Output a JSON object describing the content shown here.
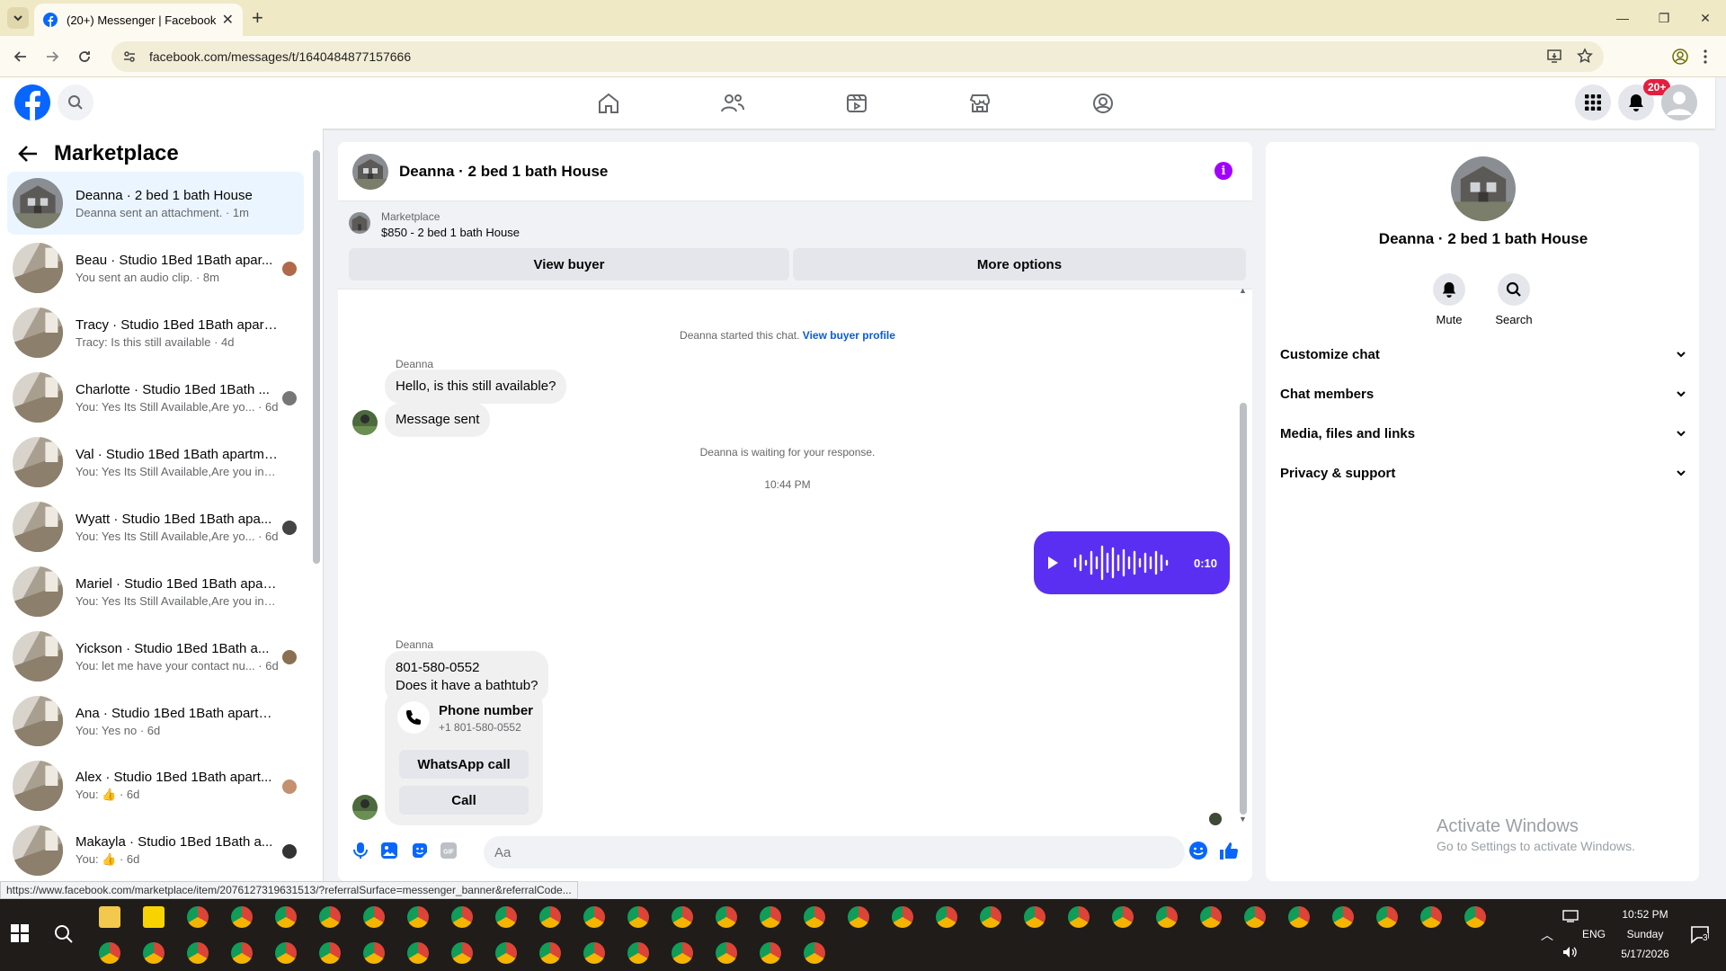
{
  "browser": {
    "tab_title": "(20+) Messenger | Facebook",
    "url": "facebook.com/messages/t/1640484877157666",
    "status_url": "https://www.facebook.com/marketplace/item/2076127319631513/?referralSurface=messenger_banner&referralCode..."
  },
  "header": {
    "notification_badge": "20+"
  },
  "sidebar": {
    "title": "Marketplace",
    "conversations": [
      {
        "name": "Deanna · 2 bed 1 bath House",
        "preview": "Deanna sent an attachment. · 1m"
      },
      {
        "name": "Beau · Studio 1Bed 1Bath apar...",
        "preview": "You sent an audio clip. · 8m"
      },
      {
        "name": "Tracy · Studio 1Bed 1Bath apart...",
        "preview": "Tracy: Is this still available · 4d"
      },
      {
        "name": "Charlotte · Studio 1Bed 1Bath ...",
        "preview": "You: Yes Its Still Available,Are yo... · 6d"
      },
      {
        "name": "Val · Studio 1Bed 1Bath apartment",
        "preview": "You: Yes Its Still Available,Are you in... · 6d"
      },
      {
        "name": "Wyatt · Studio 1Bed 1Bath apa...",
        "preview": "You: Yes Its Still Available,Are yo... · 6d"
      },
      {
        "name": "Mariel · Studio 1Bed 1Bath apart...",
        "preview": "You: Yes Its Still Available,Are you in... · 6d"
      },
      {
        "name": "Yickson · Studio 1Bed 1Bath a...",
        "preview": "You: let me have your contact nu... · 6d"
      },
      {
        "name": "Ana · Studio 1Bed 1Bath apartm...",
        "preview": "You: Yes no · 6d"
      },
      {
        "name": "Alex · Studio 1Bed 1Bath apart...",
        "preview": "You: 👍 · 6d"
      },
      {
        "name": "Makayla · Studio 1Bed 1Bath a...",
        "preview": "You: 👍 · 6d"
      }
    ]
  },
  "chat": {
    "title": "Deanna · 2 bed 1 bath House",
    "banner_label": "Marketplace",
    "banner_item": "$850 - 2 bed 1 bath House",
    "view_buyer": "View buyer",
    "more_options": "More options",
    "started_text": "Deanna started this chat.",
    "view_buyer_profile": "View buyer profile",
    "sender_name": "Deanna",
    "msg1": "Hello, is this still available?",
    "msg2": "Message sent",
    "waiting_text": "Deanna is waiting for your response.",
    "timestamp": "10:44 PM",
    "audio_duration": "0:10",
    "msg3_line1": "801-580-0552",
    "msg3_line2": "Does it have a bathtub?",
    "phone_title": "Phone number",
    "phone_value": "+1 801-580-0552",
    "whatsapp_call": "WhatsApp call",
    "call": "Call",
    "composer_placeholder": "Aa"
  },
  "info": {
    "title": "Deanna · 2 bed 1 bath House",
    "mute": "Mute",
    "search": "Search",
    "rows": [
      "Customize chat",
      "Chat members",
      "Media, files and links",
      "Privacy & support"
    ],
    "watermark_line1": "Activate Windows",
    "watermark_line2": "Go to Settings to activate Windows."
  },
  "taskbar": {
    "time": "10:52 PM",
    "day": "Sunday",
    "date": "5/17/2026",
    "lang": "ENG",
    "notif_count": "3"
  },
  "colors": {
    "accent": "#0866ff",
    "outgoing_bubble": "#5b2ff2",
    "info_icon": "#a100ff",
    "badge": "#e41e3f"
  }
}
